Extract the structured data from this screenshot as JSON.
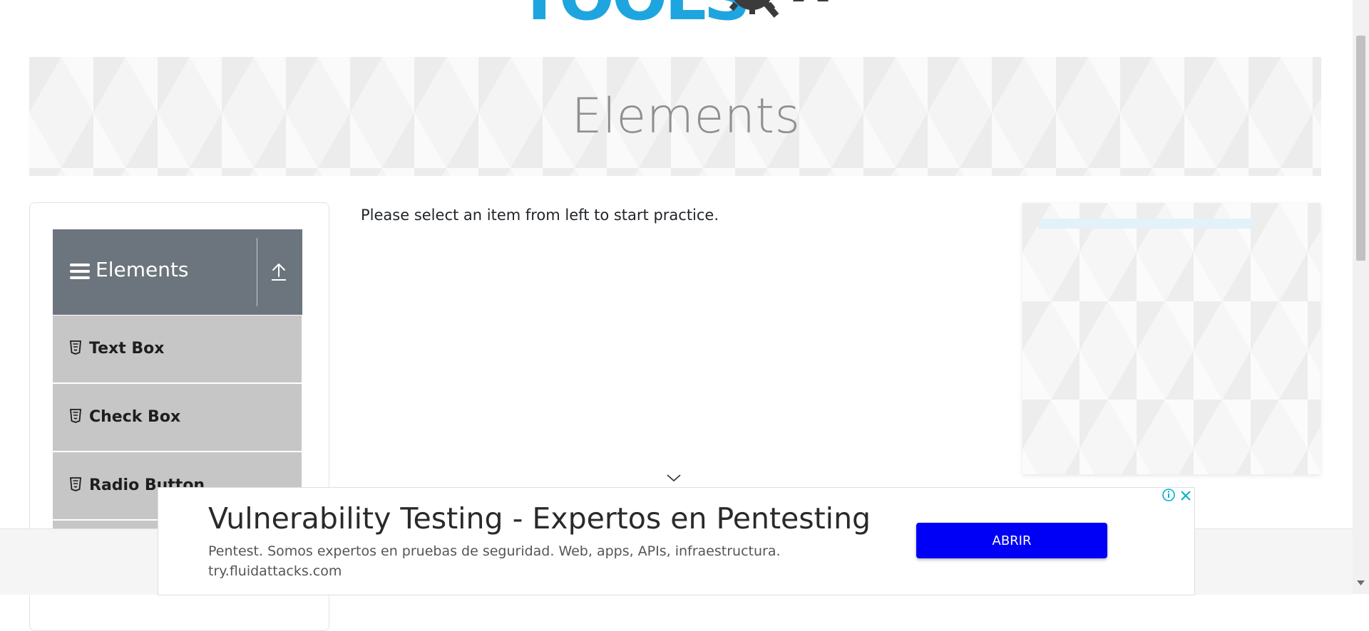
{
  "logo": {
    "text": "TOOLS",
    "brand_color": "#1ea5e0"
  },
  "banner": {
    "title": "Elements"
  },
  "sidebar": {
    "group_title": "Elements",
    "items": [
      {
        "label": "Text Box"
      },
      {
        "label": "Check Box"
      },
      {
        "label": "Radio Button"
      }
    ]
  },
  "main": {
    "prompt": "Please select an item from left to start practice."
  },
  "bottom_ad": {
    "headline": "Vulnerability Testing - Expertos en Pentesting",
    "description": "Pentest. Somos expertos en pruebas de seguridad. Web, apps, APIs, infraestructura.",
    "domain": "try.fluidattacks.com",
    "button_label": "ABRIR",
    "button_color": "#0000f7"
  },
  "colors": {
    "group_header_bg": "#6c757d",
    "menu_item_bg": "#c6c6c6",
    "banner_text": "#8f8f8f"
  },
  "icons": [
    "hamburger-icon",
    "collapse-up-icon",
    "html5-icon",
    "chevron-down-icon",
    "ad-info-icon",
    "close-icon"
  ]
}
